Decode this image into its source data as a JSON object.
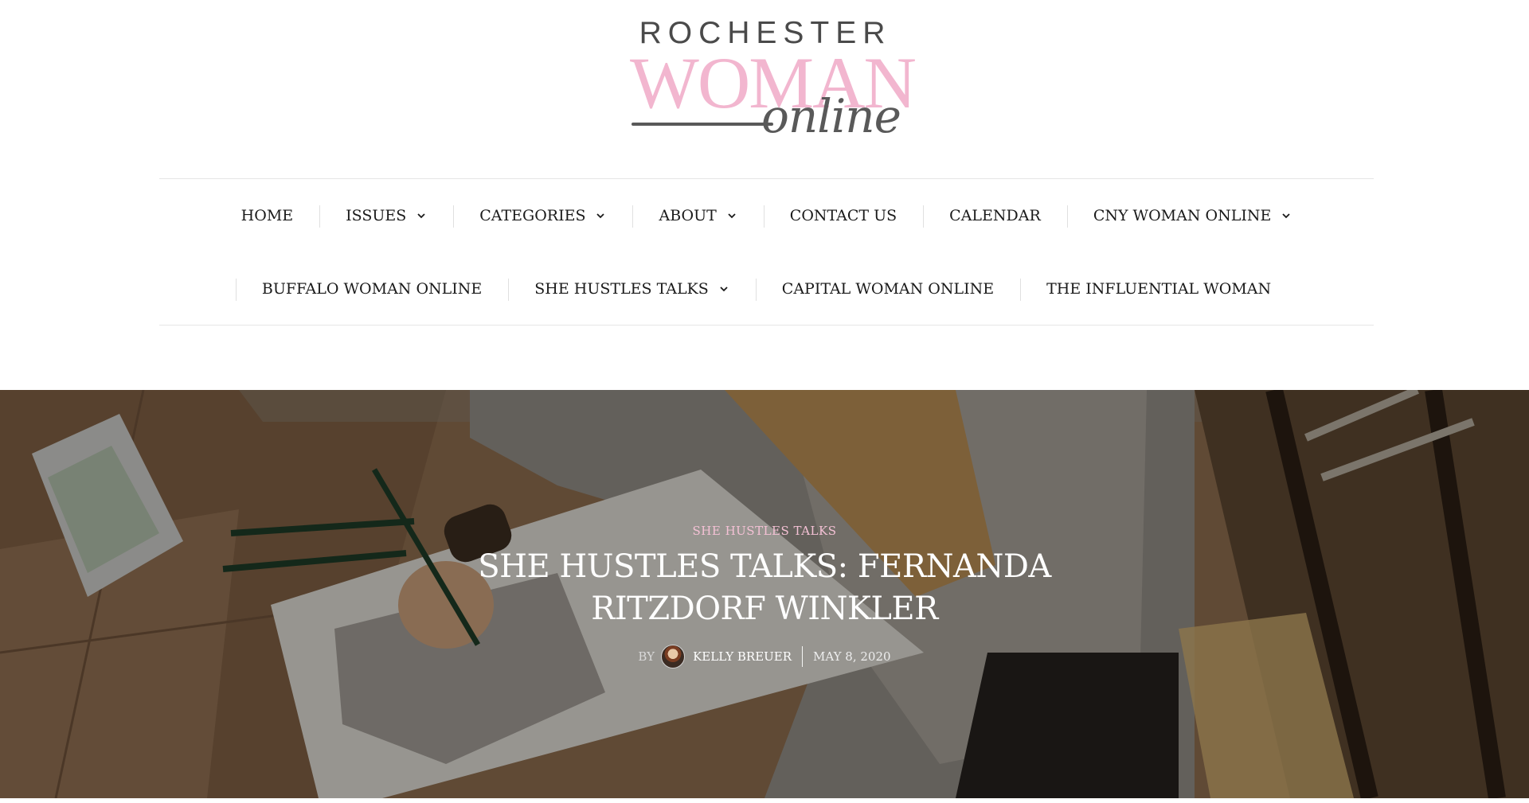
{
  "logo": {
    "line1": "ROCHESTER",
    "line2": "WOMAN",
    "line3": "online"
  },
  "nav": {
    "row1": [
      {
        "label": "HOME",
        "dropdown": false
      },
      {
        "label": "ISSUES",
        "dropdown": true
      },
      {
        "label": "CATEGORIES",
        "dropdown": true
      },
      {
        "label": "ABOUT",
        "dropdown": true
      },
      {
        "label": "CONTACT US",
        "dropdown": false
      },
      {
        "label": "CALENDAR",
        "dropdown": false
      },
      {
        "label": "CNY WOMAN ONLINE",
        "dropdown": true
      }
    ],
    "row2": [
      {
        "label": "BUFFALO WOMAN ONLINE",
        "dropdown": false
      },
      {
        "label": "SHE HUSTLES TALKS",
        "dropdown": true
      },
      {
        "label": "CAPITAL WOMAN ONLINE",
        "dropdown": false
      },
      {
        "label": "THE INFLUENTIAL WOMAN",
        "dropdown": false
      }
    ]
  },
  "hero": {
    "category": "SHE HUSTLES TALKS",
    "title_line1": "SHE HUSTLES TALKS: FERNANDA",
    "title_line2": "RITZDORF WINKLER",
    "by": "BY",
    "author": "KELLY BREUER",
    "date": "MAY 8, 2020"
  },
  "colors": {
    "logo_pink": "#f2b6cf",
    "logo_gray": "#595959",
    "category_pink": "#f4c1d5",
    "nav_text": "#1a1a1a"
  },
  "icons": {
    "dropdown": "chevron-down-icon",
    "author": "avatar"
  }
}
